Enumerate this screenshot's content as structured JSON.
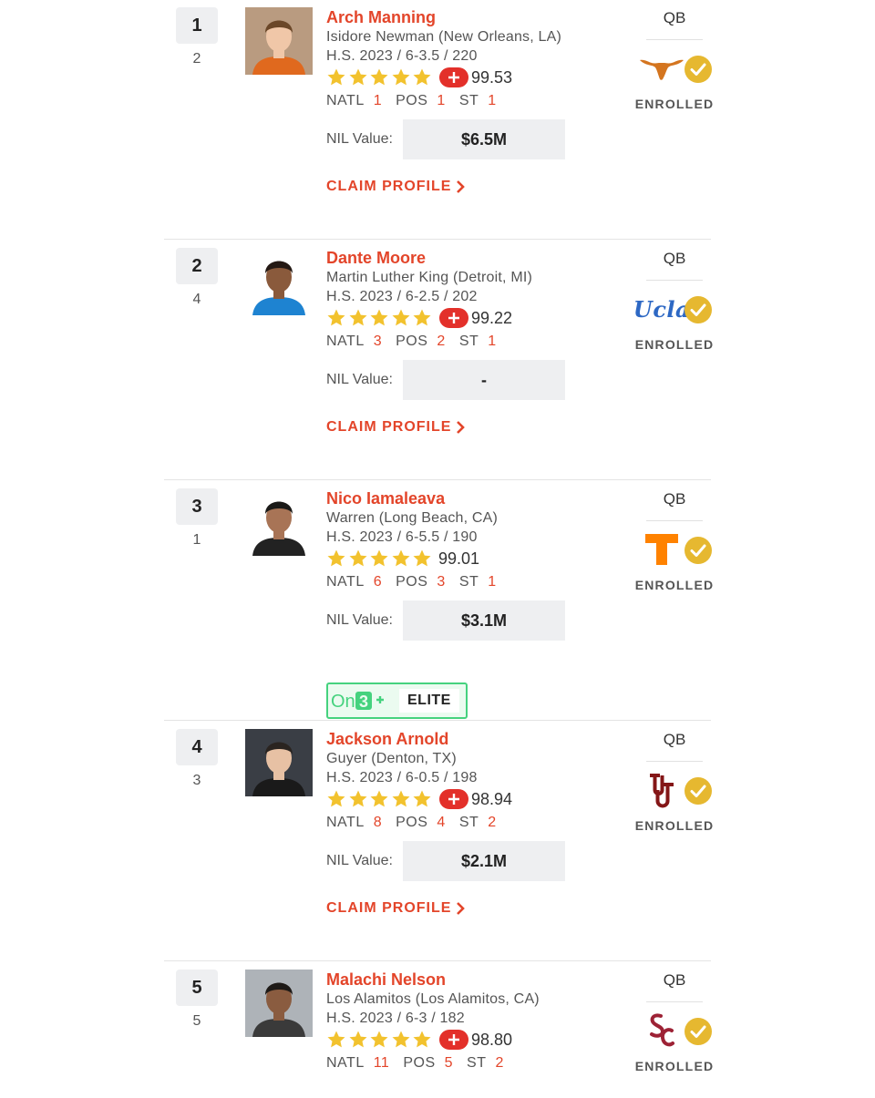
{
  "nil_label": "NIL Value:",
  "claim_label": "CLAIM PROFILE",
  "elite_label": "ELITE",
  "rank_labels": {
    "natl": "NATL",
    "pos": "POS",
    "st": "ST"
  },
  "colors": {
    "accent": "#e3452a",
    "star": "#f2c22e",
    "check": "#e6b830",
    "elite_border": "#45d27e"
  },
  "players": [
    {
      "rank": "1",
      "prev_rank": "2",
      "name": "Arch Manning",
      "school": "Isidore Newman (New Orleans, LA)",
      "hs": "H.S. 2023  /  6-3.5  /  220",
      "stars": 5,
      "score": "99.53",
      "has_plus": true,
      "natl": "1",
      "pos_rank": "1",
      "st": "1",
      "nil_value": "$6.5M",
      "footer": "claim",
      "position": "QB",
      "team": "texas-longhorn-logo",
      "status": "ENROLLED"
    },
    {
      "rank": "2",
      "prev_rank": "4",
      "name": "Dante Moore",
      "school": "Martin Luther King (Detroit, MI)",
      "hs": "H.S. 2023  /  6-2.5  /  202",
      "stars": 5,
      "score": "99.22",
      "has_plus": true,
      "natl": "3",
      "pos_rank": "2",
      "st": "1",
      "nil_value": "-",
      "footer": "claim",
      "position": "QB",
      "team": "ucla-logo",
      "team_text": "Ucla",
      "status": "ENROLLED"
    },
    {
      "rank": "3",
      "prev_rank": "1",
      "name": "Nico Iamaleava",
      "school": "Warren (Long Beach, CA)",
      "hs": "H.S. 2023  /  6-5.5  /  190",
      "stars": 5,
      "score": "99.01",
      "has_plus": false,
      "natl": "6",
      "pos_rank": "3",
      "st": "1",
      "nil_value": "$3.1M",
      "footer": "elite",
      "position": "QB",
      "team": "tennessee-t-logo",
      "status": "ENROLLED"
    },
    {
      "rank": "4",
      "prev_rank": "3",
      "name": "Jackson Arnold",
      "school": "Guyer (Denton, TX)",
      "hs": "H.S. 2023  /  6-0.5  /  198",
      "stars": 5,
      "score": "98.94",
      "has_plus": true,
      "natl": "8",
      "pos_rank": "4",
      "st": "2",
      "nil_value": "$2.1M",
      "footer": "claim",
      "position": "QB",
      "team": "oklahoma-ou-logo",
      "status": "ENROLLED"
    },
    {
      "rank": "5",
      "prev_rank": "5",
      "name": "Malachi Nelson",
      "school": "Los Alamitos (Los Alamitos, CA)",
      "hs": "H.S. 2023  /  6-3  /  182",
      "stars": 5,
      "score": "98.80",
      "has_plus": true,
      "natl": "11",
      "pos_rank": "5",
      "st": "2",
      "nil_value": "",
      "footer": "none",
      "position": "QB",
      "team": "usc-sc-logo",
      "status": "ENROLLED"
    }
  ]
}
